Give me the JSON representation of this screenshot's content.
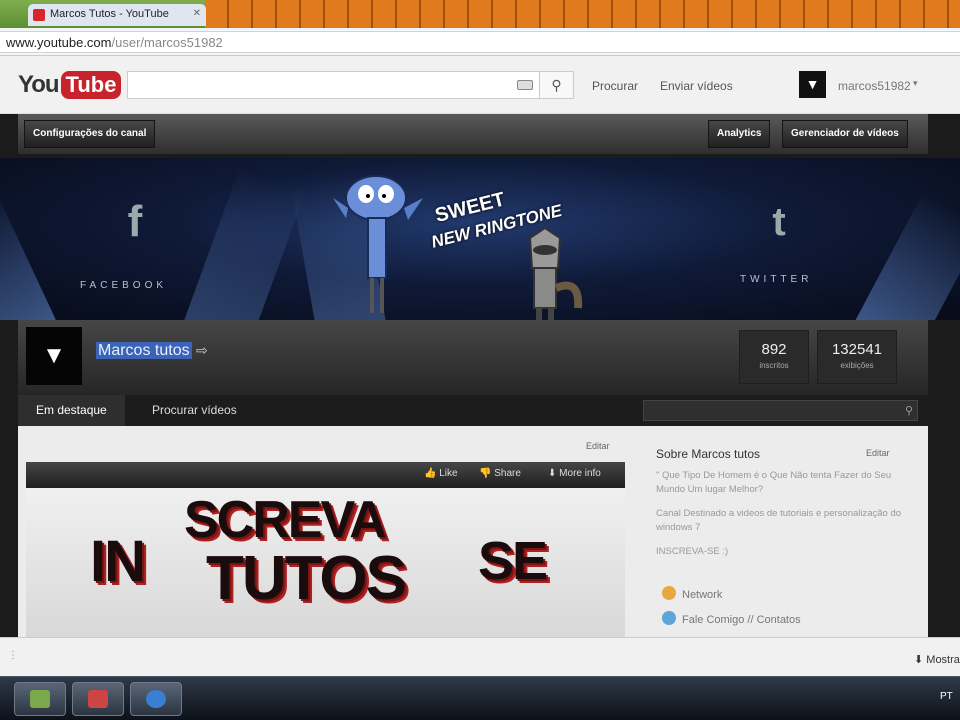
{
  "browser": {
    "tab_title": "Marcos Tutos - YouTube",
    "url_host": "www.youtube.com",
    "url_path": "/user/marcos51982"
  },
  "masthead": {
    "logo_you": "You",
    "logo_tube": "Tube",
    "search_placeholder": "",
    "links": [
      "Procurar",
      "Enviar vídeos"
    ],
    "username": "marcos51982"
  },
  "channel_toolbar": {
    "settings": "Configurações do canal",
    "analytics": "Analytics",
    "video_manager": "Gerenciador de vídeos"
  },
  "banner": {
    "left_label": "FACEBOOK",
    "right_label": "TWITTER",
    "tagline_line1": "SWEET",
    "tagline_line2": "NEW RINGTONE"
  },
  "channel": {
    "name": "Marcos tutos",
    "stats": [
      {
        "value": "892",
        "label": "inscritos"
      },
      {
        "value": "132541",
        "label": "exibições"
      }
    ]
  },
  "channel_tabs": [
    "Em destaque",
    "Procurar vídeos"
  ],
  "featured": {
    "edit": "Editar",
    "video_actions": [
      "Like",
      "Share",
      "More info"
    ],
    "poster_words": [
      "SCREVA",
      "IN",
      "TUTOS",
      "SE"
    ]
  },
  "about": {
    "title": "Sobre Marcos tutos",
    "edit": "Editar",
    "quote": "\" Que Tipo De Homem é o Que Não tenta Fazer do Seu Mundo Um lugar Melhor?",
    "description": "Canal Destinado a videos de tutoriais e personalização do windows 7",
    "cta": "INSCREVA-SE :)",
    "links": [
      "Network",
      "Fale Comigo // Contatos"
    ]
  },
  "bottom": {
    "show_all": "Mostrar"
  },
  "taskbar": {
    "language": "PT"
  }
}
